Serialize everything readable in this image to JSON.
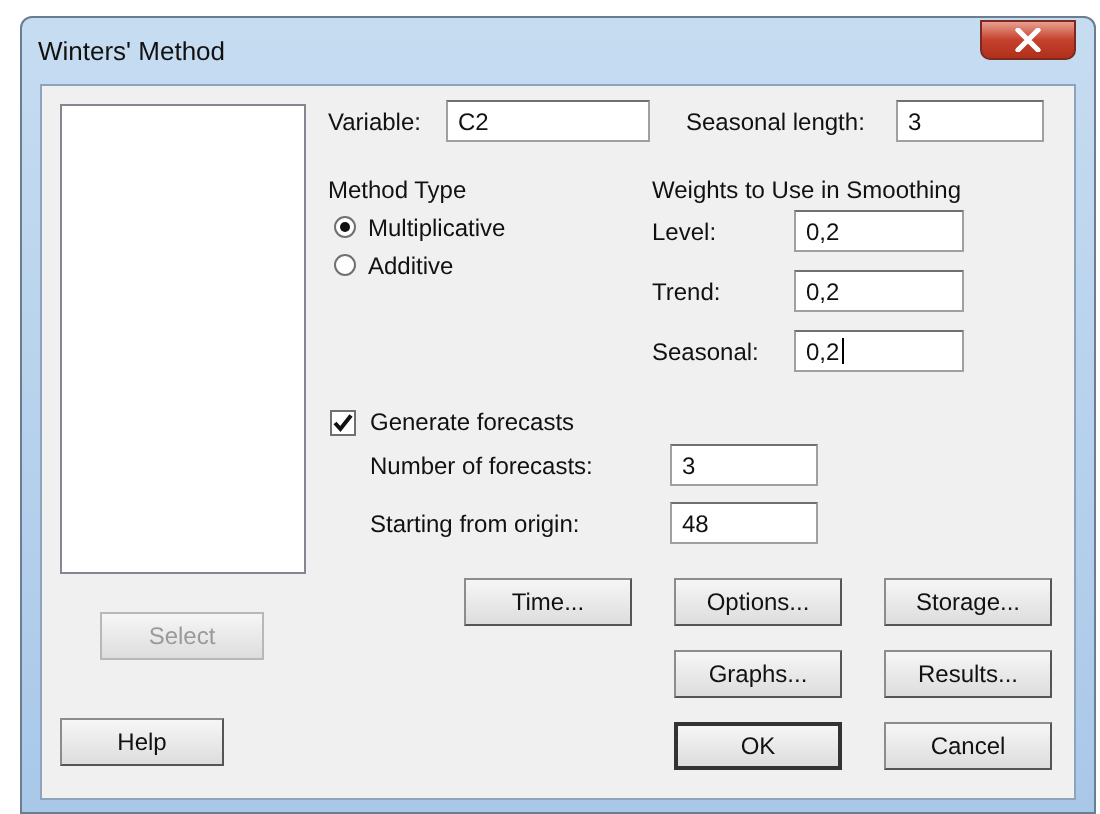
{
  "window": {
    "title": "Winters' Method"
  },
  "variable": {
    "label": "Variable:",
    "value": "C2"
  },
  "seasonal_length": {
    "label": "Seasonal length:",
    "value": "3"
  },
  "method_type": {
    "title": "Method Type",
    "options": [
      {
        "label": "Multiplicative",
        "selected": true
      },
      {
        "label": "Additive",
        "selected": false
      }
    ]
  },
  "weights": {
    "title": "Weights to Use in Smoothing",
    "fields": [
      {
        "label": "Level:",
        "value": "0,2",
        "focused": false
      },
      {
        "label": "Trend:",
        "value": "0,2",
        "focused": false
      },
      {
        "label": "Seasonal:",
        "value": "0,2",
        "focused": true
      }
    ]
  },
  "generate_forecasts": {
    "label": "Generate forecasts",
    "checked": true
  },
  "forecast_fields": [
    {
      "label": "Number of forecasts:",
      "value": "3"
    },
    {
      "label": "Starting from origin:",
      "value": "48"
    }
  ],
  "select_button": {
    "label": "Select",
    "disabled": true
  },
  "help_button": {
    "label": "Help",
    "disabled": false
  },
  "buttons": [
    {
      "label": "Time...",
      "default": false
    },
    {
      "label": "Options...",
      "default": false
    },
    {
      "label": "Storage...",
      "default": false
    },
    {
      "label": "Graphs...",
      "default": false
    },
    {
      "label": "Results...",
      "default": false
    },
    {
      "label": "OK",
      "default": true
    },
    {
      "label": "Cancel",
      "default": false
    }
  ]
}
